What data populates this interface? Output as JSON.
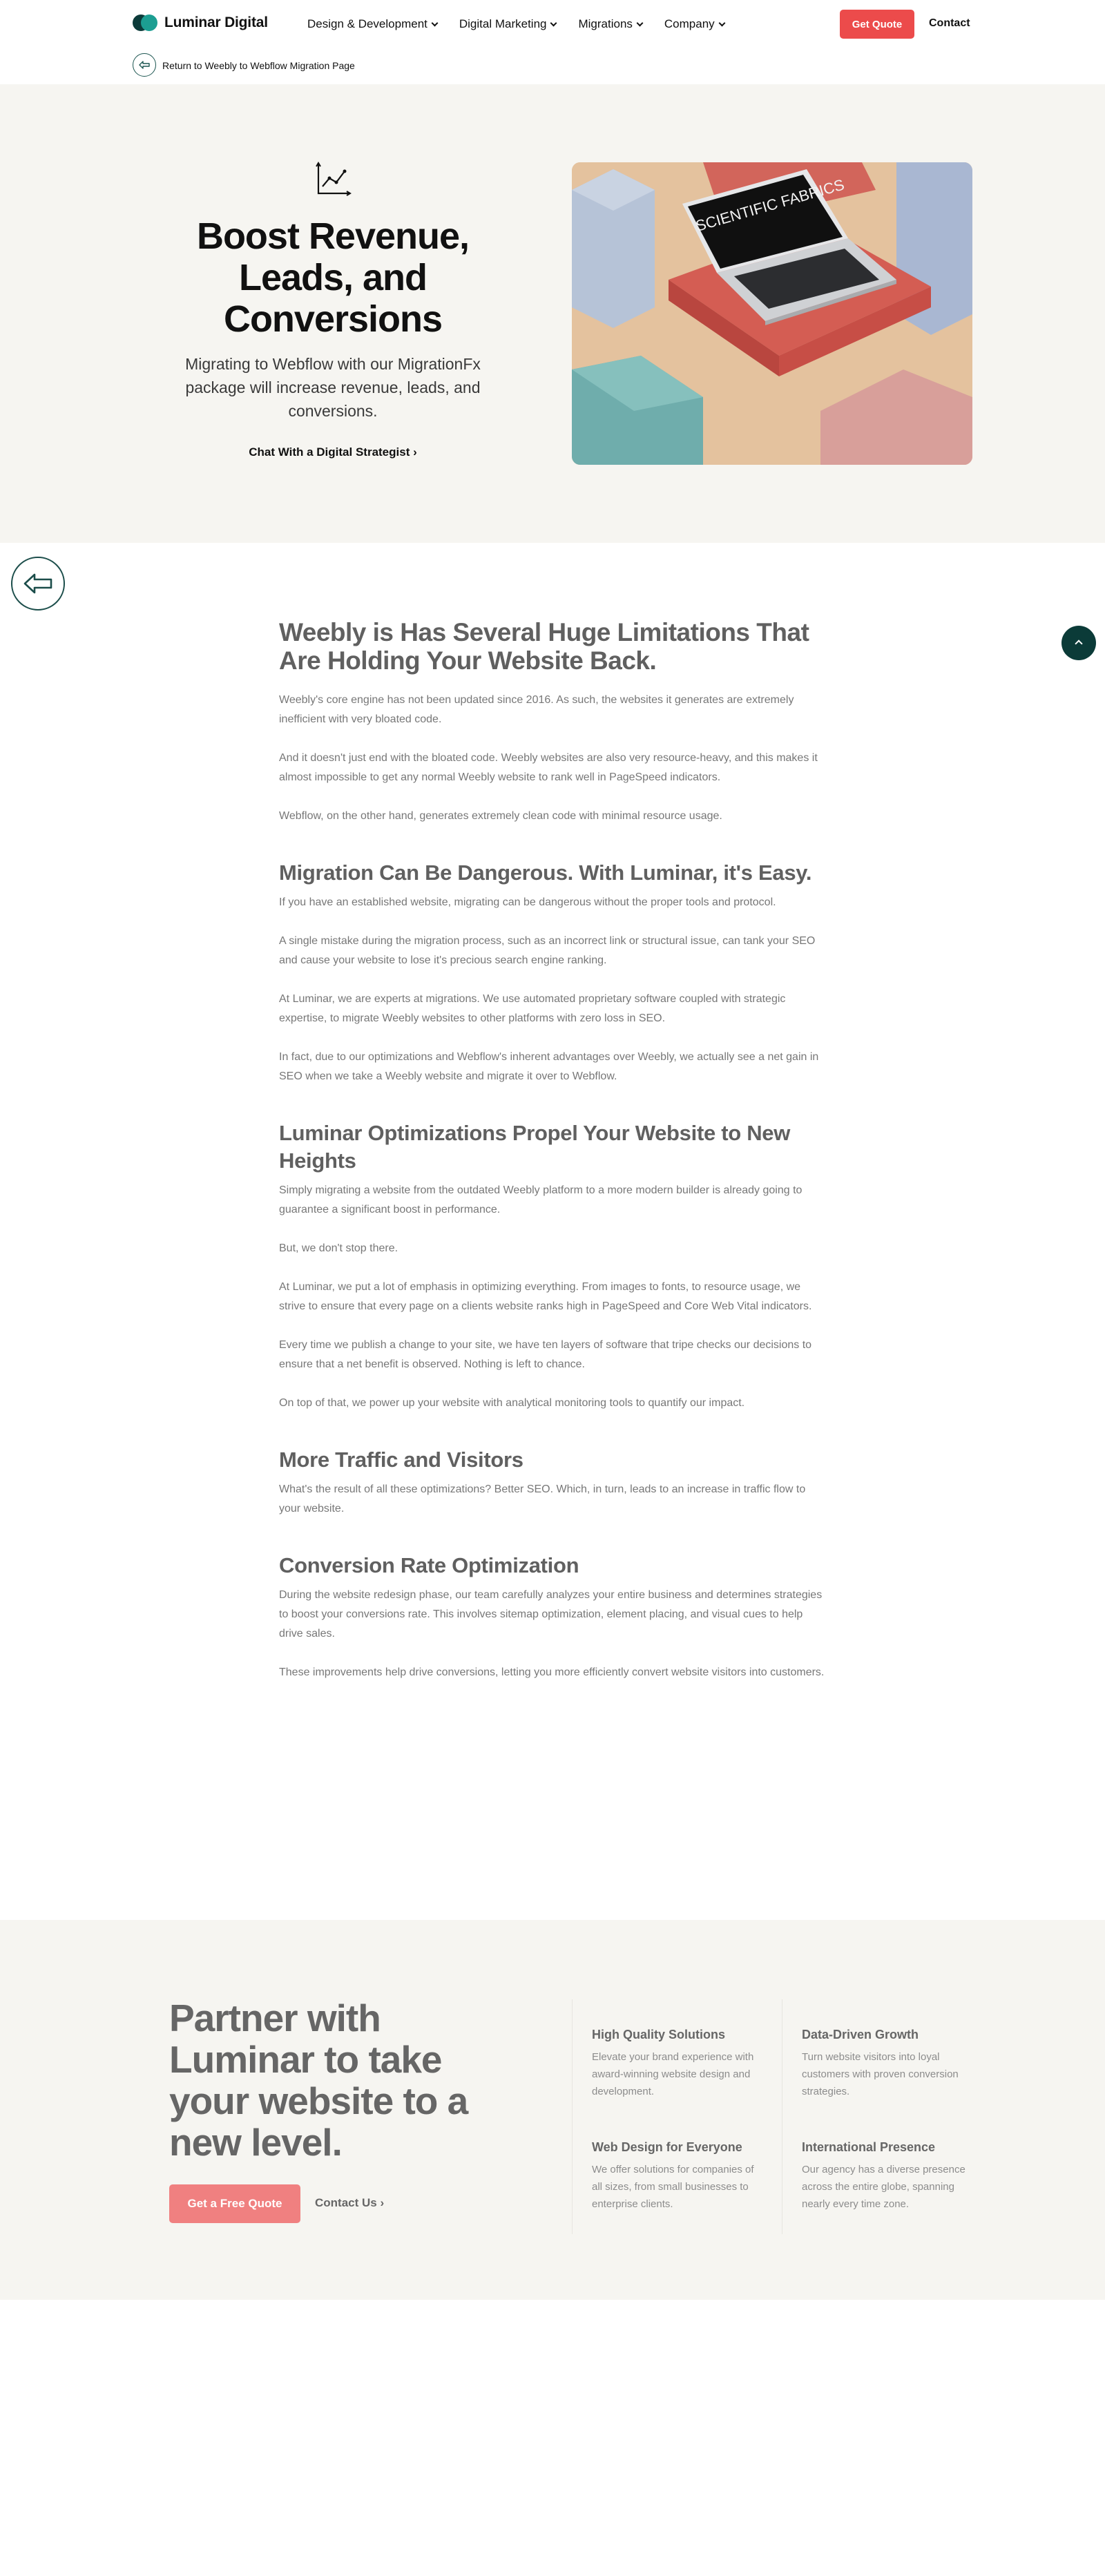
{
  "nav": {
    "logo": "Luminar Digital",
    "menu": [
      {
        "label": "Design & Development"
      },
      {
        "label": "Digital Marketing"
      },
      {
        "label": "Migrations"
      },
      {
        "label": "Company"
      }
    ],
    "get_quote": "Get Quote",
    "contact": "Contact"
  },
  "breadcrumb": {
    "label": "Return to Weebly to Webflow Migration Page",
    "icon": "arrow-left-icon"
  },
  "hero": {
    "icon": "chart-growth-icon",
    "title": "Boost Revenue, Leads, and Conversions",
    "subtitle": "Migrating to Webflow with our MigrationFx package will increase revenue, leads, and conversions.",
    "link": "Chat With a Digital Strategist",
    "image": {
      "screen_text": "SCIENTIFIC FABRICS",
      "colors": {
        "bg": "#e2c2a0",
        "laptop_base": "#d04f47",
        "block_blue": "#aebdd4",
        "block_teal": "#6aa9a9",
        "block_pink": "#d9a39e"
      }
    }
  },
  "floating": {
    "back_icon": "arrow-left-icon",
    "top_icon": "chevron-up-icon"
  },
  "article": {
    "sections": [
      {
        "heading": "Weebly is Has Several Huge Limitations That Are Holding Your Website Back.",
        "paragraphs": [
          "Weebly's core engine has not been updated since 2016. As such, the websites it generates are extremely inefficient with very bloated code.",
          "And it doesn't just end with the bloated code. Weebly websites are also very resource-heavy, and this makes it almost impossible to get any normal Weebly website to rank well in PageSpeed indicators.",
          "Webflow, on the other hand, generates extremely clean code with minimal resource usage."
        ]
      },
      {
        "heading": "Migration Can Be Dangerous. With Luminar, it's Easy.",
        "paragraphs": [
          "If you have an established website, migrating can be dangerous without the proper tools and protocol.",
          "A single mistake during the migration process, such as an incorrect link or structural issue, can tank your SEO and cause your website to lose it's precious search engine ranking.",
          "At Luminar, we are experts at migrations. We use automated proprietary software coupled with strategic expertise, to migrate Weebly websites to other platforms with zero loss in SEO.",
          "In fact, due to our optimizations and Webflow's inherent advantages over Weebly, we actually see a net gain in SEO when we take a Weebly website and migrate it over to Webflow."
        ]
      },
      {
        "heading": "Luminar Optimizations Propel Your Website to New Heights",
        "paragraphs": [
          "Simply migrating a website from the outdated Weebly platform to a more modern builder is already going to guarantee a significant boost in performance.",
          "But, we don't stop there.",
          "At Luminar, we put a lot of emphasis in optimizing everything. From images to fonts, to resource usage, we strive to ensure that every page on a clients website ranks high in PageSpeed and Core Web Vital indicators.",
          "Every time we publish a change to your site, we have ten layers of software that tripe checks our decisions to ensure that a net benefit is observed. Nothing is left to chance.",
          "On top of that, we power up your website with analytical monitoring tools to quantify our impact."
        ]
      },
      {
        "heading": "More Traffic and Visitors",
        "paragraphs": [
          "What's the result of all these optimizations? Better SEO. Which, in turn, leads to an increase in traffic flow to your website."
        ]
      },
      {
        "heading": "Conversion Rate Optimization",
        "paragraphs": [
          "During the website redesign phase, our team carefully analyzes your entire business and determines strategies to boost your conversions rate. This involves sitemap optimization, element placing, and visual cues to help drive sales.",
          "These improvements help drive conversions, letting you more efficiently convert website visitors into customers."
        ]
      }
    ]
  },
  "cta": {
    "title": "Partner with Luminar to take your website to a new level.",
    "button": "Get a Free Quote",
    "contact": "Contact Us",
    "features": [
      {
        "title": "High Quality Solutions",
        "text": "Elevate your brand experience with award-winning website design and development."
      },
      {
        "title": "Data-Driven Growth",
        "text": "Turn website visitors into loyal customers with proven conversion strategies."
      },
      {
        "title": "Web Design for Everyone",
        "text": "We offer solutions for companies of all sizes, from small businesses to enterprise clients."
      },
      {
        "title": "International Presence",
        "text": "Our agency has a diverse presence across the entire globe, spanning nearly every time zone."
      }
    ]
  }
}
